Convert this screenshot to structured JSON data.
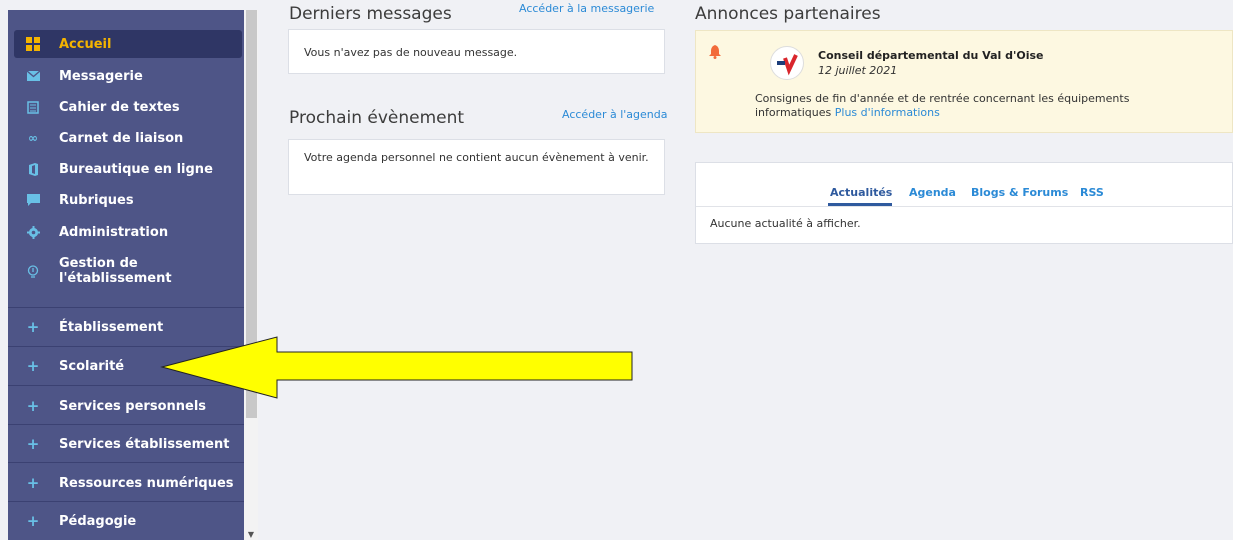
{
  "sidebar": {
    "active_item": {
      "label": "Accueil",
      "icon": "grid-icon"
    },
    "items": [
      {
        "label": "Messagerie",
        "icon": "mail-icon"
      },
      {
        "label": "Cahier de textes",
        "icon": "notebook-icon"
      },
      {
        "label": "Carnet de liaison",
        "icon": "infinity-icon"
      },
      {
        "label": "Bureautique en ligne",
        "icon": "office-icon"
      },
      {
        "label": "Rubriques",
        "icon": "chat-icon"
      },
      {
        "label": "Administration",
        "icon": "gear-icon"
      },
      {
        "label": "Gestion de l'établissement",
        "icon": "lightbulb-icon"
      }
    ],
    "sections": [
      {
        "label": "Établissement",
        "icon": "plus-icon"
      },
      {
        "label": "Scolarité",
        "icon": "plus-icon"
      },
      {
        "label": "Services personnels",
        "icon": "plus-icon"
      },
      {
        "label": "Services établissement",
        "icon": "plus-icon"
      },
      {
        "label": "Ressources numériques",
        "icon": "plus-icon"
      },
      {
        "label": "Pédagogie",
        "icon": "plus-icon"
      }
    ]
  },
  "messages": {
    "title": "Derniers messages",
    "link": "Accéder à la messagerie",
    "empty": "Vous n'avez pas de nouveau message."
  },
  "agenda": {
    "title": "Prochain évènement",
    "link": "Accéder à l'agenda",
    "empty": "Votre agenda personnel ne contient aucun évènement à venir."
  },
  "partners": {
    "title": "Annonces partenaires",
    "icon": "bell-icon",
    "org": "Conseil départemental du Val d'Oise",
    "date": "12 juillet 2021",
    "description": "Consignes de fin d'année et de rentrée concernant les équipements informatiques",
    "more_link": "Plus d'informations"
  },
  "news": {
    "tabs": [
      "Actualités",
      "Agenda",
      "Blogs & Forums",
      "RSS"
    ],
    "active_tab": "Actualités",
    "empty": "Aucune actualité à afficher."
  },
  "colors": {
    "sidebar_bg": "#4e5587",
    "active_accent": "#f4b400",
    "link": "#2b8ad6",
    "annotation_arrow": "#ffff00"
  }
}
